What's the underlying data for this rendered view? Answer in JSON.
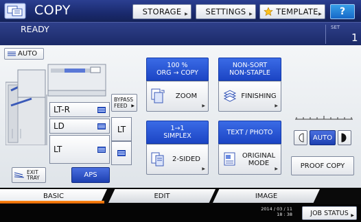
{
  "header": {
    "title": "COPY",
    "buttons": {
      "storage": "STORAGE",
      "settings": "SETTINGS",
      "template": "TEMPLATE",
      "help": "?"
    }
  },
  "status": {
    "text": "READY",
    "set_label": "SET",
    "set_value": "1"
  },
  "paper": {
    "auto_label": "AUTO",
    "bypass_label_1": "BYPASS",
    "bypass_label_2": "FEED",
    "bypass_size": "LT",
    "trays": [
      {
        "size": "LT-R"
      },
      {
        "size": "LD"
      },
      {
        "size": "LT"
      }
    ],
    "exit_tray_1": "EXIT",
    "exit_tray_2": "TRAY",
    "aps": "APS"
  },
  "functions": {
    "zoom": {
      "top1": "100 %",
      "top2": "ORG → COPY",
      "label": "ZOOM"
    },
    "finishing": {
      "top1": "NON-SORT",
      "top2": "NON-STAPLE",
      "label": "FINISHING"
    },
    "sided": {
      "top1": "1→1",
      "top2": "SIMPLEX",
      "label": "2-SIDED"
    },
    "original": {
      "top1": "TEXT / PHOTO",
      "label1": "ORIGINAL",
      "label2": "MODE"
    }
  },
  "density": {
    "auto": "AUTO"
  },
  "proof_copy": "PROOF COPY",
  "tabs": [
    "BASIC",
    "EDIT",
    "IMAGE"
  ],
  "footer": {
    "date": "2014 / 03 / 11",
    "time": "18 : 38",
    "job_status": "JOB STATUS"
  },
  "colors": {
    "header_blue": "#1a2a6e",
    "accent_blue": "#1c45c4",
    "tab_accent": "#e26600"
  },
  "icons": {
    "app": "copier-icon",
    "template": "star-icon",
    "zoom": "zoom-icon",
    "finishing": "finishing-icon",
    "sided": "two-sided-icon",
    "original": "original-mode-icon"
  }
}
